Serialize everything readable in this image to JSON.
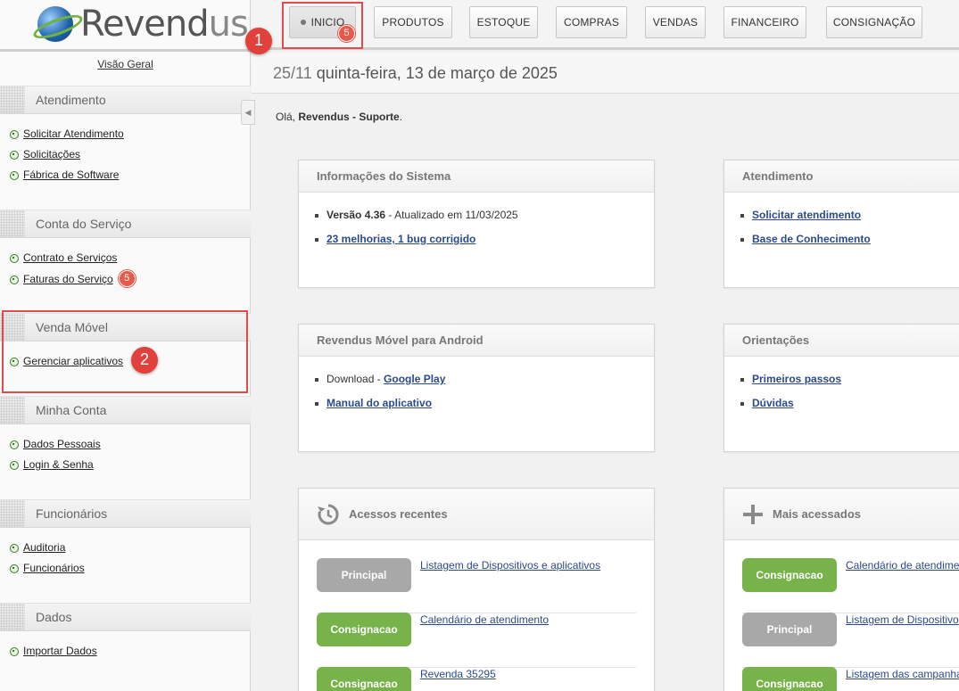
{
  "brand": {
    "name_main": "Revend",
    "name_tail": "us"
  },
  "sidebar": {
    "overview_label": "Visão Geral",
    "sections": [
      {
        "title": "Atendimento",
        "links": [
          "Solicitar Atendimento",
          "Solicitações",
          "Fábrica de Software"
        ]
      },
      {
        "title": "Conta do Serviço",
        "links": [
          "Contrato e Serviços",
          "Faturas do Serviço"
        ],
        "invoice_badge": "5"
      },
      {
        "title": "Venda Móvel",
        "links": [
          "Gerenciar aplicativos"
        ]
      },
      {
        "title": "Minha Conta",
        "links": [
          "Dados Pessoais",
          "Login & Senha"
        ]
      },
      {
        "title": "Funcionários",
        "links": [
          "Auditoria",
          "Funcionários"
        ]
      },
      {
        "title": "Dados",
        "links": [
          "Importar Dados"
        ]
      }
    ]
  },
  "topnav": {
    "items": [
      "INICIO",
      "PRODUTOS",
      "ESTOQUE",
      "COMPRAS",
      "VENDAS",
      "FINANCEIRO",
      "CONSIGNAÇÃO"
    ],
    "inicio_badge": "5"
  },
  "header": {
    "day_count": "25/11",
    "date_text": "quinta-feira, 13 de março de 2025"
  },
  "greeting": {
    "prefix": "Olá,",
    "user": "Revendus - Suporte",
    "suffix": "."
  },
  "panels": {
    "system_info": {
      "title": "Informações do Sistema",
      "version_label": "Versão 4.36",
      "version_suffix": " - Atualizado em 11/03/2025",
      "changes_link": "23 melhorias, 1 bug corrigido"
    },
    "support": {
      "title": "Atendimento",
      "links": [
        "Solicitar atendimento",
        "Base de Conhecimento"
      ]
    },
    "android": {
      "title": "Revendus Móvel para Android",
      "download_label": "Download - ",
      "store_link": "Google Play",
      "manual_link": "Manual do aplicativo"
    },
    "guidance": {
      "title": "Orientações",
      "links": [
        "Primeiros passos",
        "Dúvidas"
      ]
    },
    "recent": {
      "title": "Acessos recentes",
      "rows": [
        {
          "tag": "Principal",
          "tag_color": "#a8a8a8",
          "link": "Listagem de Dispositivos e aplicativos"
        },
        {
          "tag": "Consignacao",
          "tag_color": "#77b34a",
          "link": "Calendário de atendimento"
        },
        {
          "tag": "Consignacao",
          "tag_color": "#77b34a",
          "link": "Revenda 35295"
        }
      ]
    },
    "most_accessed": {
      "title": "Mais acessados",
      "rows": [
        {
          "tag": "Consignacao",
          "tag_color": "#77b34a",
          "link": "Calendário de atendime"
        },
        {
          "tag": "Principal",
          "tag_color": "#a8a8a8",
          "link": "Listagem de Dispositivo"
        },
        {
          "tag": "Consignacao",
          "tag_color": "#77b34a",
          "link": "Listagem das campanha"
        }
      ]
    }
  },
  "annotations": {
    "step1": "1",
    "step2": "2",
    "highlight_color": "#e34a4a"
  }
}
